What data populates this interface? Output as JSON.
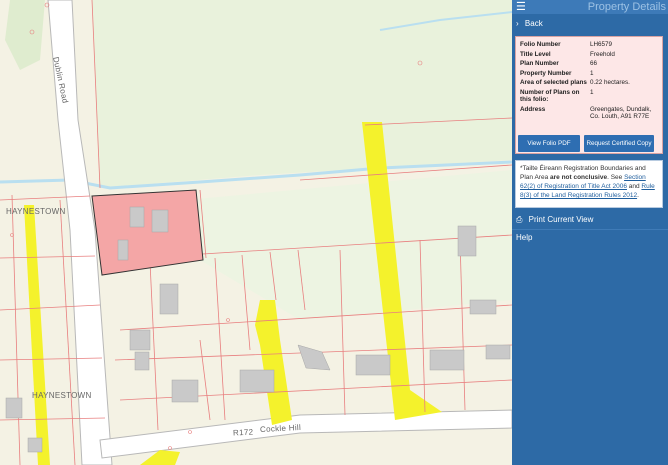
{
  "map": {
    "labels": {
      "dublin_road": "Dublin Road",
      "haynestown_1": "HAYNESTOWN",
      "haynestown_2": "HAYNESTOWN",
      "r172": "R172",
      "cockle_hill": "Cockle Hill"
    },
    "colors": {
      "background": "#f4f2e4",
      "field": "#e9f2dc",
      "road": "#ffffff",
      "road_edge": "#b8b8b8",
      "boundary": "#e87f7f",
      "selected_parcel": "#f4a6a6",
      "building": "#c9c9c9",
      "highlight_road": "#f4f22c",
      "river": "#b9dff0"
    }
  },
  "panel": {
    "title": "Property Details",
    "menu_icon": "menu-icon",
    "back": {
      "icon": "›",
      "label": "Back"
    },
    "details": [
      {
        "key": "Folio Number",
        "value": "LH6579"
      },
      {
        "key": "Title Level",
        "value": "Freehold"
      },
      {
        "key": "Plan Number",
        "value": "66"
      },
      {
        "key": "Property Number",
        "value": "1"
      },
      {
        "key": "Area of selected plans",
        "value": "0.22 hectares."
      },
      {
        "key": "Number of Plans on this folio:",
        "value": "1"
      },
      {
        "key": "Address",
        "value": "Greengates, Dundalk, Co. Louth, A91 R77E"
      }
    ],
    "buttons": {
      "view_folio": "View Folio PDF",
      "request_copy": "Request Certified Copy"
    },
    "notice": {
      "prefix": "*Tailte Éireann Registration Boundaries and Plan Area ",
      "bold": "are not conclusive",
      "mid": ". See ",
      "link1": "Section 62(2) of Registration of Title Act 2006",
      "and": " and ",
      "link2": "Rule 8(3) of the Land Registration Rules 2012",
      "end": "."
    },
    "print": {
      "icon": "print-icon",
      "label": "Print Current View"
    },
    "help": "Help",
    "colors": {
      "panel_bg": "#2d6aa6",
      "details_bg": "#fde7e7",
      "button_bg": "#2e6eb2"
    }
  }
}
